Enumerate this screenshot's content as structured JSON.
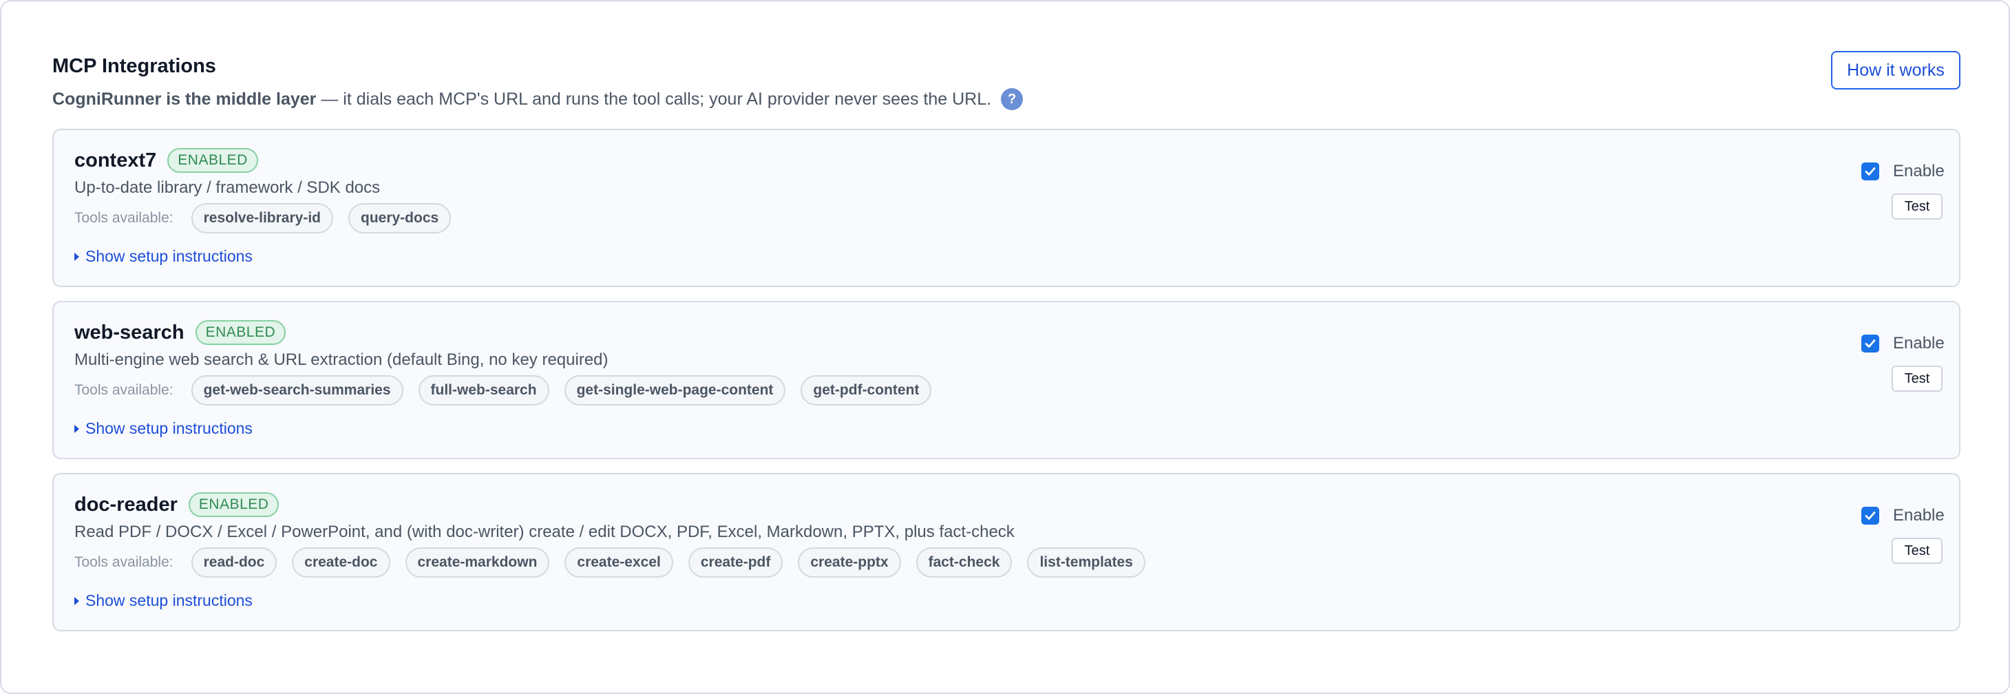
{
  "header": {
    "title": "MCP Integrations",
    "subtitle_bold": "CogniRunner is the middle layer",
    "subtitle_rest": " — it dials each MCP's URL and runs the tool calls; your AI provider never sees the URL.",
    "help_glyph": "?",
    "how_it_works_label": "How it works"
  },
  "common": {
    "tools_label": "Tools available:",
    "setup_label": "Show setup instructions",
    "enable_label": "Enable",
    "test_label": "Test"
  },
  "integrations": [
    {
      "name": "context7",
      "status": "ENABLED",
      "description": "Up-to-date library / framework / SDK docs",
      "enabled": true,
      "tools": [
        "resolve-library-id",
        "query-docs"
      ]
    },
    {
      "name": "web-search",
      "status": "ENABLED",
      "description": "Multi-engine web search & URL extraction (default Bing, no key required)",
      "enabled": true,
      "tools": [
        "get-web-search-summaries",
        "full-web-search",
        "get-single-web-page-content",
        "get-pdf-content"
      ]
    },
    {
      "name": "doc-reader",
      "status": "ENABLED",
      "description": "Read PDF / DOCX / Excel / PowerPoint, and (with doc-writer) create / edit DOCX, PDF, Excel, Markdown, PPTX, plus fact-check",
      "enabled": true,
      "tools": [
        "read-doc",
        "create-doc",
        "create-markdown",
        "create-excel",
        "create-pdf",
        "create-pptx",
        "fact-check",
        "list-templates"
      ]
    }
  ],
  "colors": {
    "accent": "#1d4ed8",
    "checkbox": "#1a73e8",
    "badge_text": "#2f8a52",
    "badge_bg": "#e3f5ea"
  }
}
